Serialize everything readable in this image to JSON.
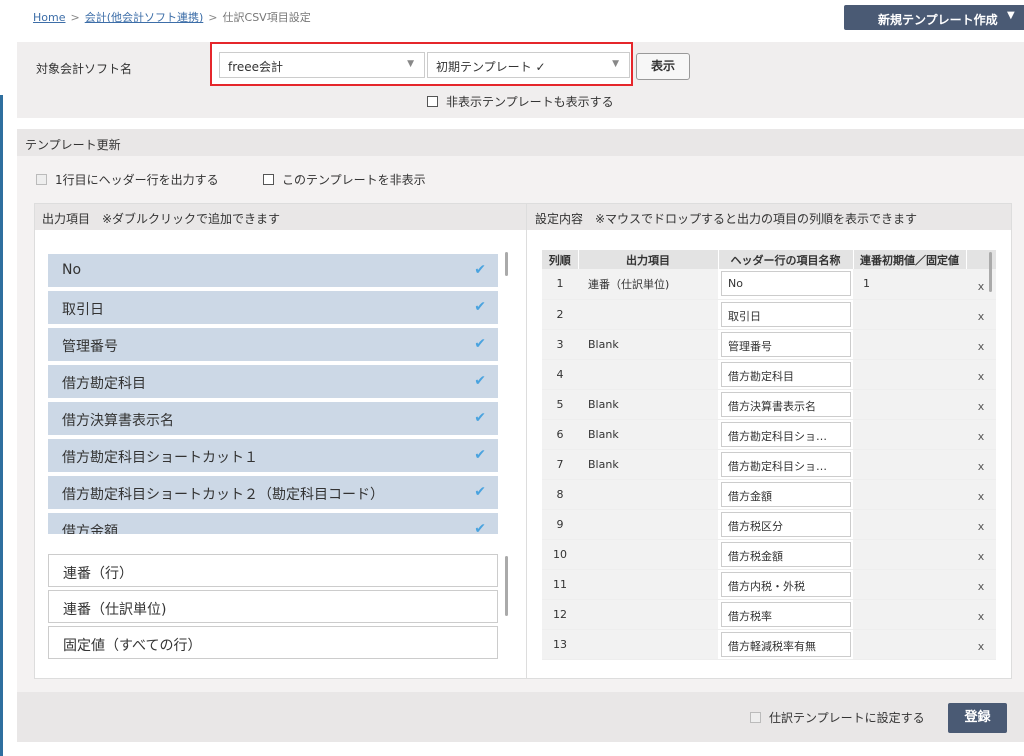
{
  "breadcrumb": {
    "home": "Home",
    "accounting": "会計(他会計ソフト連携)",
    "current": "仕訳CSV項目設定",
    "sep": ">"
  },
  "header": {
    "new_template_label": "新規テンプレート作成",
    "dropdown_arrow": "▼"
  },
  "selector": {
    "label": "対象会計ソフト名",
    "software_value": "freee会計",
    "template_value": "初期テンプレート ✓",
    "show_button": "表示",
    "show_hidden_label": "非表示テンプレートも表示する",
    "accent_color": "#e5262b"
  },
  "update": {
    "title": "テンプレート更新",
    "header_row_label": "1行目にヘッダー行を出力する",
    "hide_template_label": "このテンプレートを非表示"
  },
  "output_panel": {
    "title": "出力項目　※ダブルクリックで追加できます",
    "selected_items": [
      "No",
      "取引日",
      "管理番号",
      "借方勘定科目",
      "借方決算書表示名",
      "借方勘定科目ショートカット１",
      "借方勘定科目ショートカット２（勘定科目コード）",
      "借方金額"
    ],
    "available_items": [
      "連番（行）",
      "連番（仕訳単位)",
      "固定値（すべての行）"
    ]
  },
  "settings_panel": {
    "title": "設定内容　※マウスでドロップすると出力の項目の列順を表示できます",
    "columns": [
      "列順",
      "出力項目",
      "ヘッダー行の項目名称",
      "連番初期値／固定値"
    ],
    "rows": [
      {
        "no": "1",
        "out": "連番（仕訳単位)",
        "hdr": "No",
        "init": "1"
      },
      {
        "no": "2",
        "out": "",
        "hdr": "取引日",
        "init": ""
      },
      {
        "no": "3",
        "out": "Blank",
        "hdr": "管理番号",
        "init": ""
      },
      {
        "no": "4",
        "out": "",
        "hdr": "借方勘定科目",
        "init": ""
      },
      {
        "no": "5",
        "out": "Blank",
        "hdr": "借方決算書表示名",
        "init": ""
      },
      {
        "no": "6",
        "out": "Blank",
        "hdr": "借方勘定科目ショ…",
        "init": ""
      },
      {
        "no": "7",
        "out": "Blank",
        "hdr": "借方勘定科目ショ…",
        "init": ""
      },
      {
        "no": "8",
        "out": "",
        "hdr": "借方金額",
        "init": ""
      },
      {
        "no": "9",
        "out": "",
        "hdr": "借方税区分",
        "init": ""
      },
      {
        "no": "10",
        "out": "",
        "hdr": "借方税金額",
        "init": ""
      },
      {
        "no": "11",
        "out": "",
        "hdr": "借方内税・外税",
        "init": ""
      },
      {
        "no": "12",
        "out": "",
        "hdr": "借方税率",
        "init": ""
      },
      {
        "no": "13",
        "out": "",
        "hdr": "借方軽減税率有無",
        "init": ""
      }
    ],
    "remove_label": "x"
  },
  "footer": {
    "journal_template_label": "仕訳テンプレートに設定する",
    "register_button": "登録"
  }
}
